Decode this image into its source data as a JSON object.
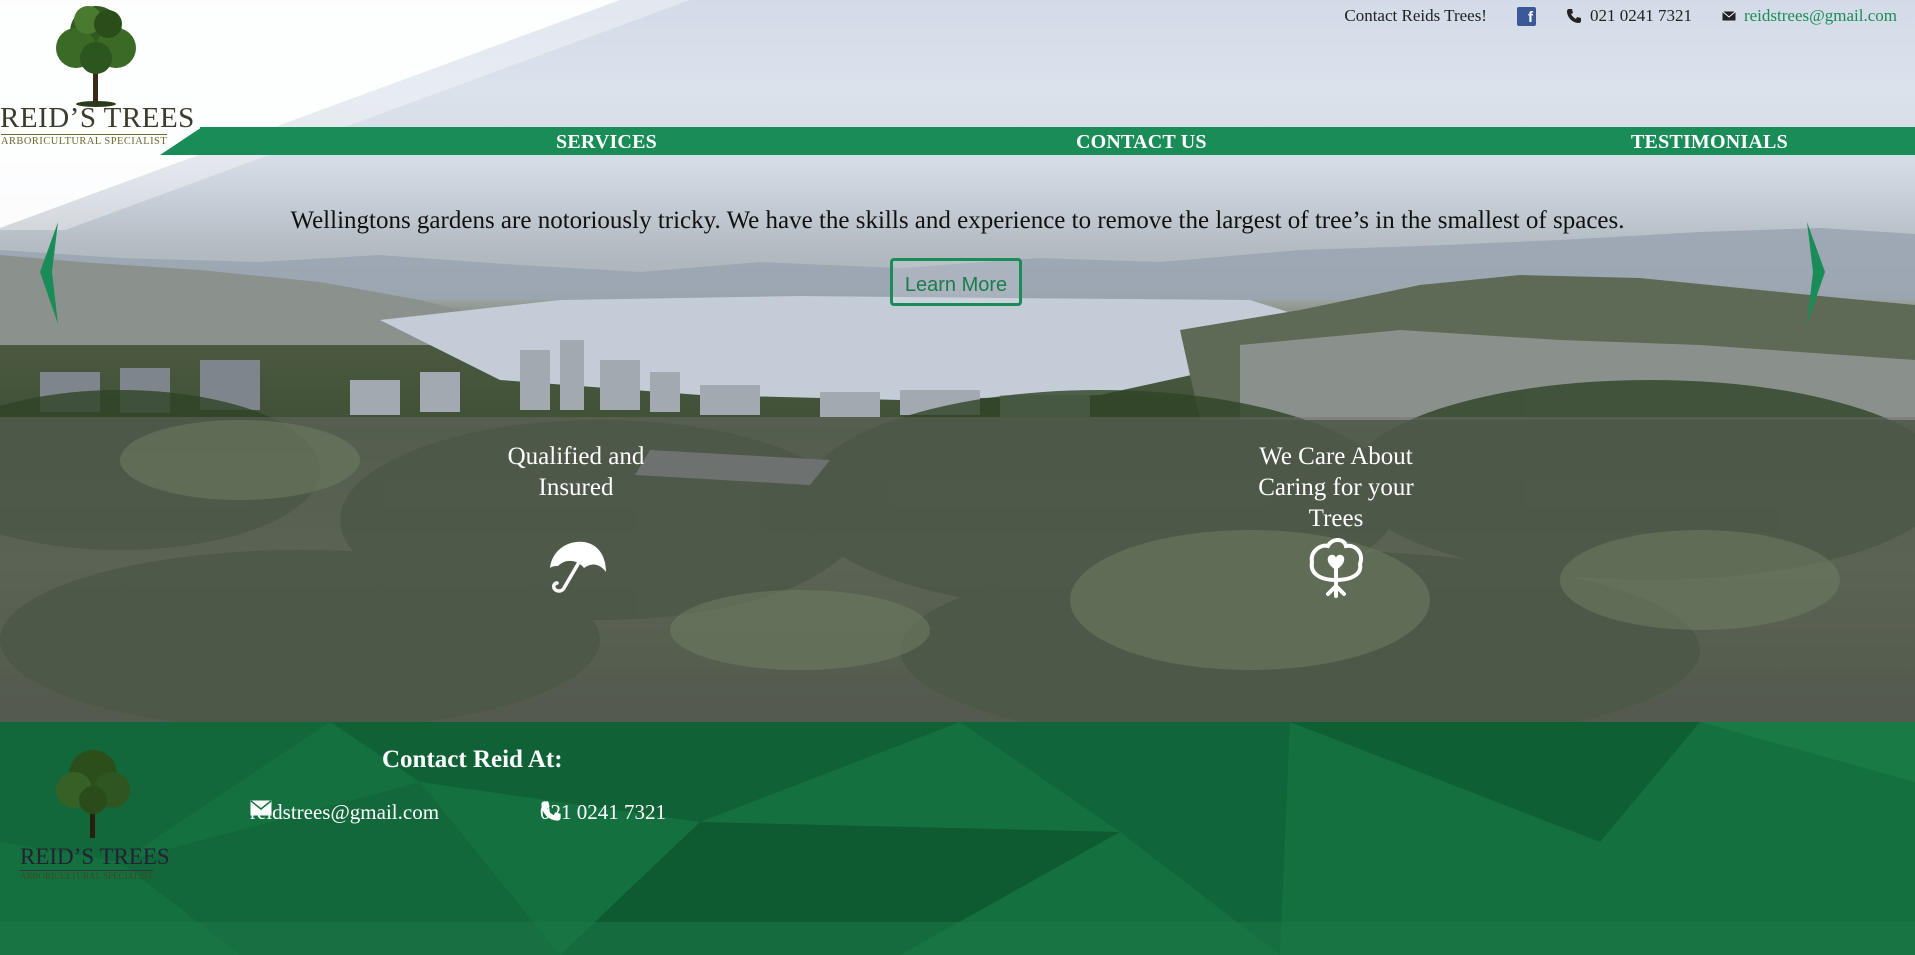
{
  "topbar": {
    "contact_label": "Contact Reids Trees!",
    "facebook_icon": "facebook-icon",
    "phone": "021 0241 7321",
    "email": "reidstrees@gmail.com"
  },
  "logo": {
    "name": "REID’S TREES",
    "subtitle": "ARBORICULTURAL SPECIALIST"
  },
  "nav": {
    "items": [
      {
        "label": "SERVICES"
      },
      {
        "label": "CONTACT US"
      },
      {
        "label": "TESTIMONIALS"
      }
    ]
  },
  "slider": {
    "tagline": "Wellingtons gardens are notoriously tricky. We have the skills and experience to remove the largest of tree’s in the smallest of spaces.",
    "button_label": "Learn More",
    "prev_icon": "arrow-left-icon",
    "next_icon": "arrow-right-icon"
  },
  "features": [
    {
      "title_line1": "Qualified and",
      "title_line2": "Insured",
      "title_line3": "",
      "icon": "umbrella-icon"
    },
    {
      "title_line1": "We Care About",
      "title_line2": "Caring for your",
      "title_line3": "Trees",
      "icon": "tree-heart-icon"
    }
  ],
  "footer": {
    "title": "Contact Reid At:",
    "email": "reidstrees@gmail.com",
    "phone": "021 0241 7321",
    "logo_name": "REID’S TREES",
    "logo_subtitle": "ARBORICULTURAL SPECIALIST"
  },
  "colors": {
    "brand_green": "#1a8c57",
    "footer_green": "#15703f",
    "facebook_blue": "#3b5998"
  }
}
